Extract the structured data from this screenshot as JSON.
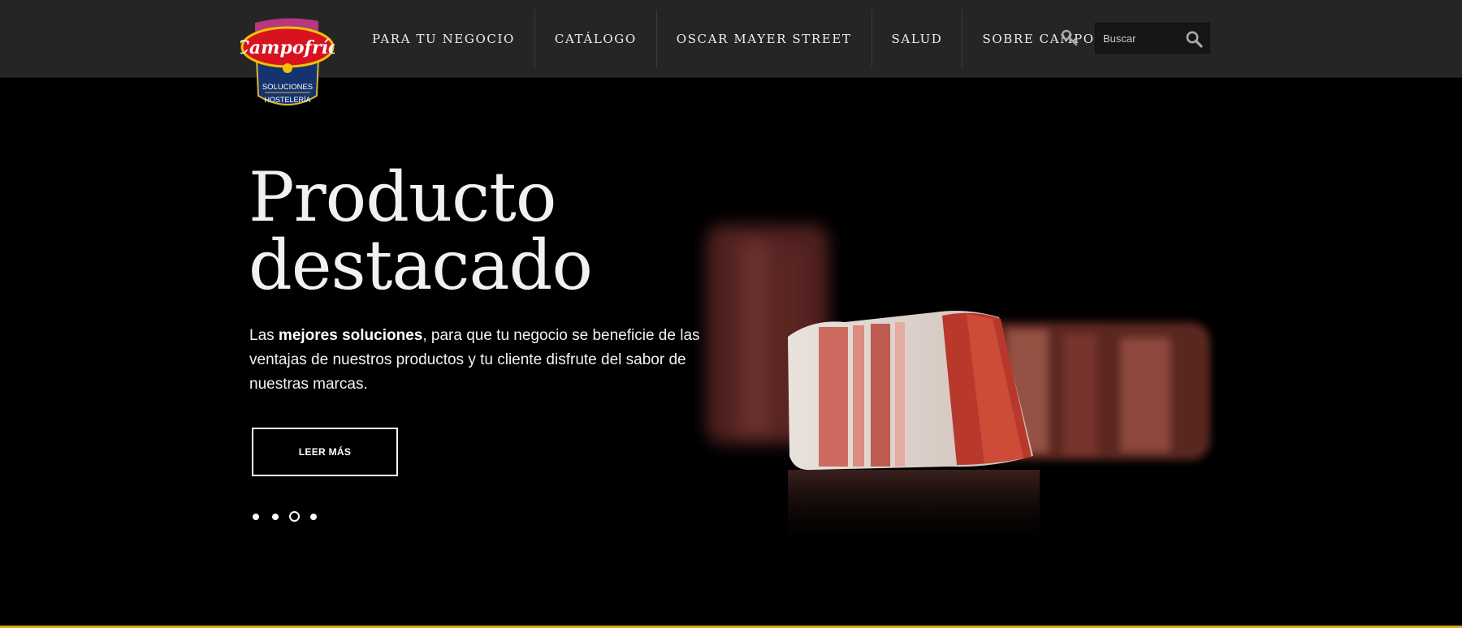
{
  "brand": {
    "name": "Campofrío",
    "sub_line1": "SOLUCIONES",
    "sub_line2": "HOSTELERÍA"
  },
  "nav": {
    "items": [
      {
        "label": "PARA TU NEGOCIO"
      },
      {
        "label": "CATÁLOGO"
      },
      {
        "label": "OSCAR MAYER STREET"
      },
      {
        "label": "SALUD"
      },
      {
        "label": "SOBRE CAMPOFRÍO"
      }
    ]
  },
  "search": {
    "placeholder": "Buscar"
  },
  "hero": {
    "title_line1": "Producto",
    "title_line2": "destacado",
    "text_prefix": "Las ",
    "text_bold": "mejores soluciones",
    "text_suffix": ", para que tu negocio se beneficie de las ventajas de nuestros productos y tu cliente disfrute del sabor de nuestras marcas.",
    "cta_label": "LEER MÁS"
  },
  "carousel": {
    "slide_count": 4,
    "active_index": 2
  },
  "colors": {
    "header_bg": "#252525",
    "accent_gold": "#d6a81a",
    "logo_red": "#d8121f",
    "logo_blue": "#15336e"
  },
  "icons": {
    "key": "key-icon",
    "search": "search-icon"
  }
}
